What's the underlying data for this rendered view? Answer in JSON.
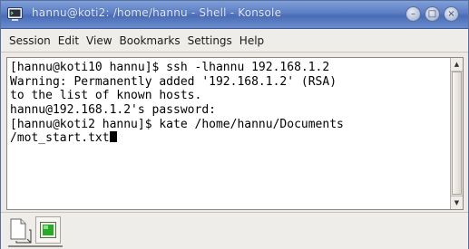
{
  "window": {
    "title": "hannu@koti2: /home/hannu - Shell - Konsole",
    "title_color": "#5b7dc4"
  },
  "menubar": {
    "items": [
      "Session",
      "Edit",
      "View",
      "Bookmarks",
      "Settings",
      "Help"
    ]
  },
  "terminal": {
    "lines": [
      "[hannu@koti10 hannu]$ ssh -lhannu 192.168.1.2",
      "Warning: Permanently added '192.168.1.2' (RSA)",
      "to the list of known hosts.",
      "hannu@192.168.1.2's password:",
      "[hannu@koti2 hannu]$ kate /home/hannu/Documents",
      "/mot_start.txt"
    ],
    "background": "#ffffff",
    "foreground": "#000000"
  },
  "tabbar": {
    "new_session_icon": "new-document-icon",
    "session_icon": "terminal-session-icon"
  }
}
